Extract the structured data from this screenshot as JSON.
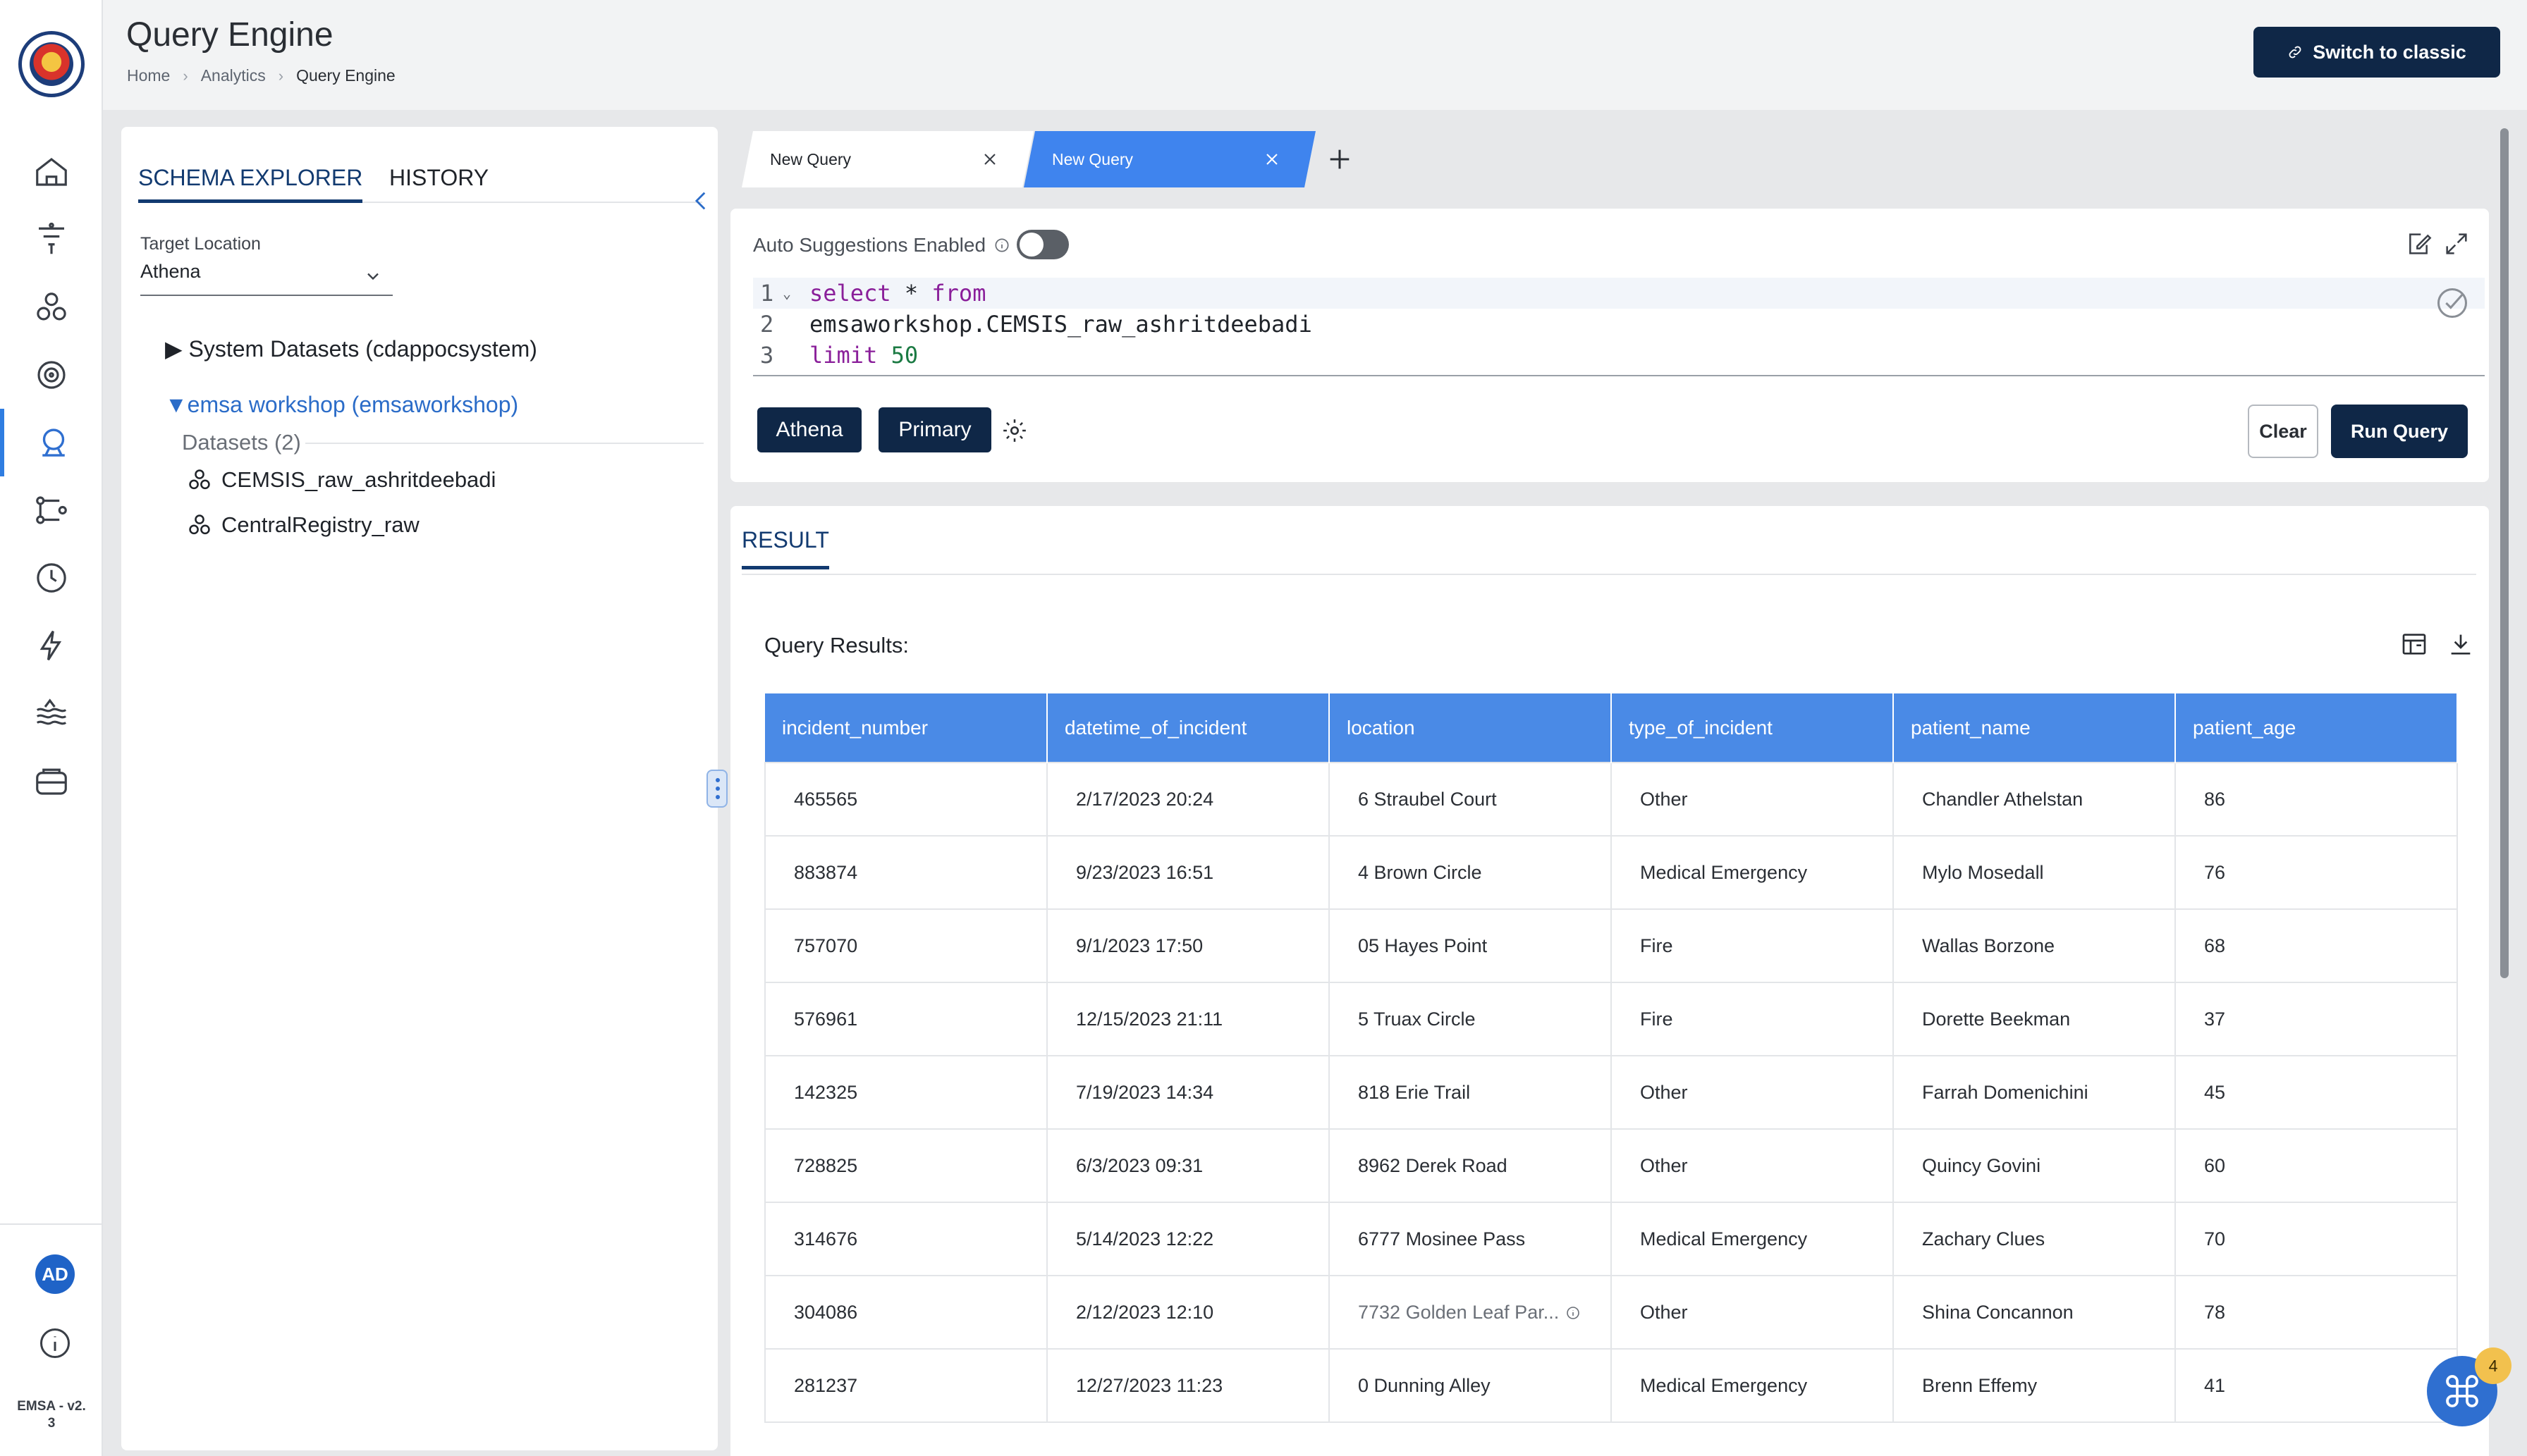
{
  "app": {
    "page_title": "Query Engine",
    "breadcrumb": [
      "Home",
      "Analytics",
      "Query Engine"
    ],
    "switch_button": "Switch to classic",
    "version": "EMSA - v2.\n3",
    "avatar_initials": "AD"
  },
  "nav": {
    "icons": [
      "home-icon",
      "filter-funnel-icon",
      "datasets-icon",
      "target-icon",
      "query-engine-icon",
      "pipeline-icon",
      "clock-icon",
      "lightning-icon",
      "data-lake-icon",
      "storage-icon"
    ],
    "active_index": 4
  },
  "schema": {
    "tabs": [
      "SCHEMA EXPLORER",
      "HISTORY"
    ],
    "target_location_label": "Target Location",
    "target_location_value": "Athena",
    "tree": {
      "system": "▶ System Datasets (cdappocsystem)",
      "emsa": "▼emsa workshop (emsaworkshop)",
      "datasets_label": "Datasets (2)",
      "datasets": [
        "CEMSIS_raw_ashritdeebadi",
        "CentralRegistry_raw"
      ]
    }
  },
  "query_tabs": [
    "New Query",
    "New Query"
  ],
  "editor": {
    "auto_suggestions_label": "Auto Suggestions Enabled",
    "auto_suggestions_on": false,
    "lines": [
      {
        "num": "1",
        "kw": "select",
        "rest": " * ",
        "kw2": "from"
      },
      {
        "num": "2",
        "text": "emsaworkshop.CEMSIS_raw_ashritdeebadi"
      },
      {
        "num": "3",
        "kw": "limit",
        "numval": "50"
      }
    ],
    "engine_chip": "Athena",
    "workgroup_chip": "Primary",
    "clear_label": "Clear",
    "run_label": "Run Query"
  },
  "result": {
    "tab": "RESULT",
    "label": "Query Results:",
    "columns": [
      "incident_number",
      "datetime_of_incident",
      "location",
      "type_of_incident",
      "patient_name",
      "patient_age"
    ],
    "rows": [
      [
        "465565",
        "2/17/2023 20:24",
        "6 Straubel Court",
        "Other",
        "Chandler Athelstan",
        "86"
      ],
      [
        "883874",
        "9/23/2023 16:51",
        "4 Brown Circle",
        "Medical Emergency",
        "Mylo Mosedall",
        "76"
      ],
      [
        "757070",
        "9/1/2023 17:50",
        "05 Hayes Point",
        "Fire",
        "Wallas Borzone",
        "68"
      ],
      [
        "576961",
        "12/15/2023 21:11",
        "5 Truax Circle",
        "Fire",
        "Dorette Beekman",
        "37"
      ],
      [
        "142325",
        "7/19/2023 14:34",
        "818 Erie Trail",
        "Other",
        "Farrah Domenichini",
        "45"
      ],
      [
        "728825",
        "6/3/2023 09:31",
        "8962 Derek Road",
        "Other",
        "Quincy Govini",
        "60"
      ],
      [
        "314676",
        "5/14/2023 12:22",
        "6777 Mosinee Pass",
        "Medical Emergency",
        "Zachary Clues",
        "70"
      ],
      [
        "304086",
        "2/12/2023 12:10",
        "7732 Golden Leaf Par...",
        "Other",
        "Shina Concannon",
        "78"
      ],
      [
        "281237",
        "12/27/2023 11:23",
        "0 Dunning Alley",
        "Medical Emergency",
        "Brenn Effemy",
        "41"
      ]
    ]
  },
  "fab_badge": "4",
  "colors": {
    "primary_navy": "#0f2747",
    "accent_blue": "#3f84ee",
    "header_blue": "#4a8ae6"
  }
}
